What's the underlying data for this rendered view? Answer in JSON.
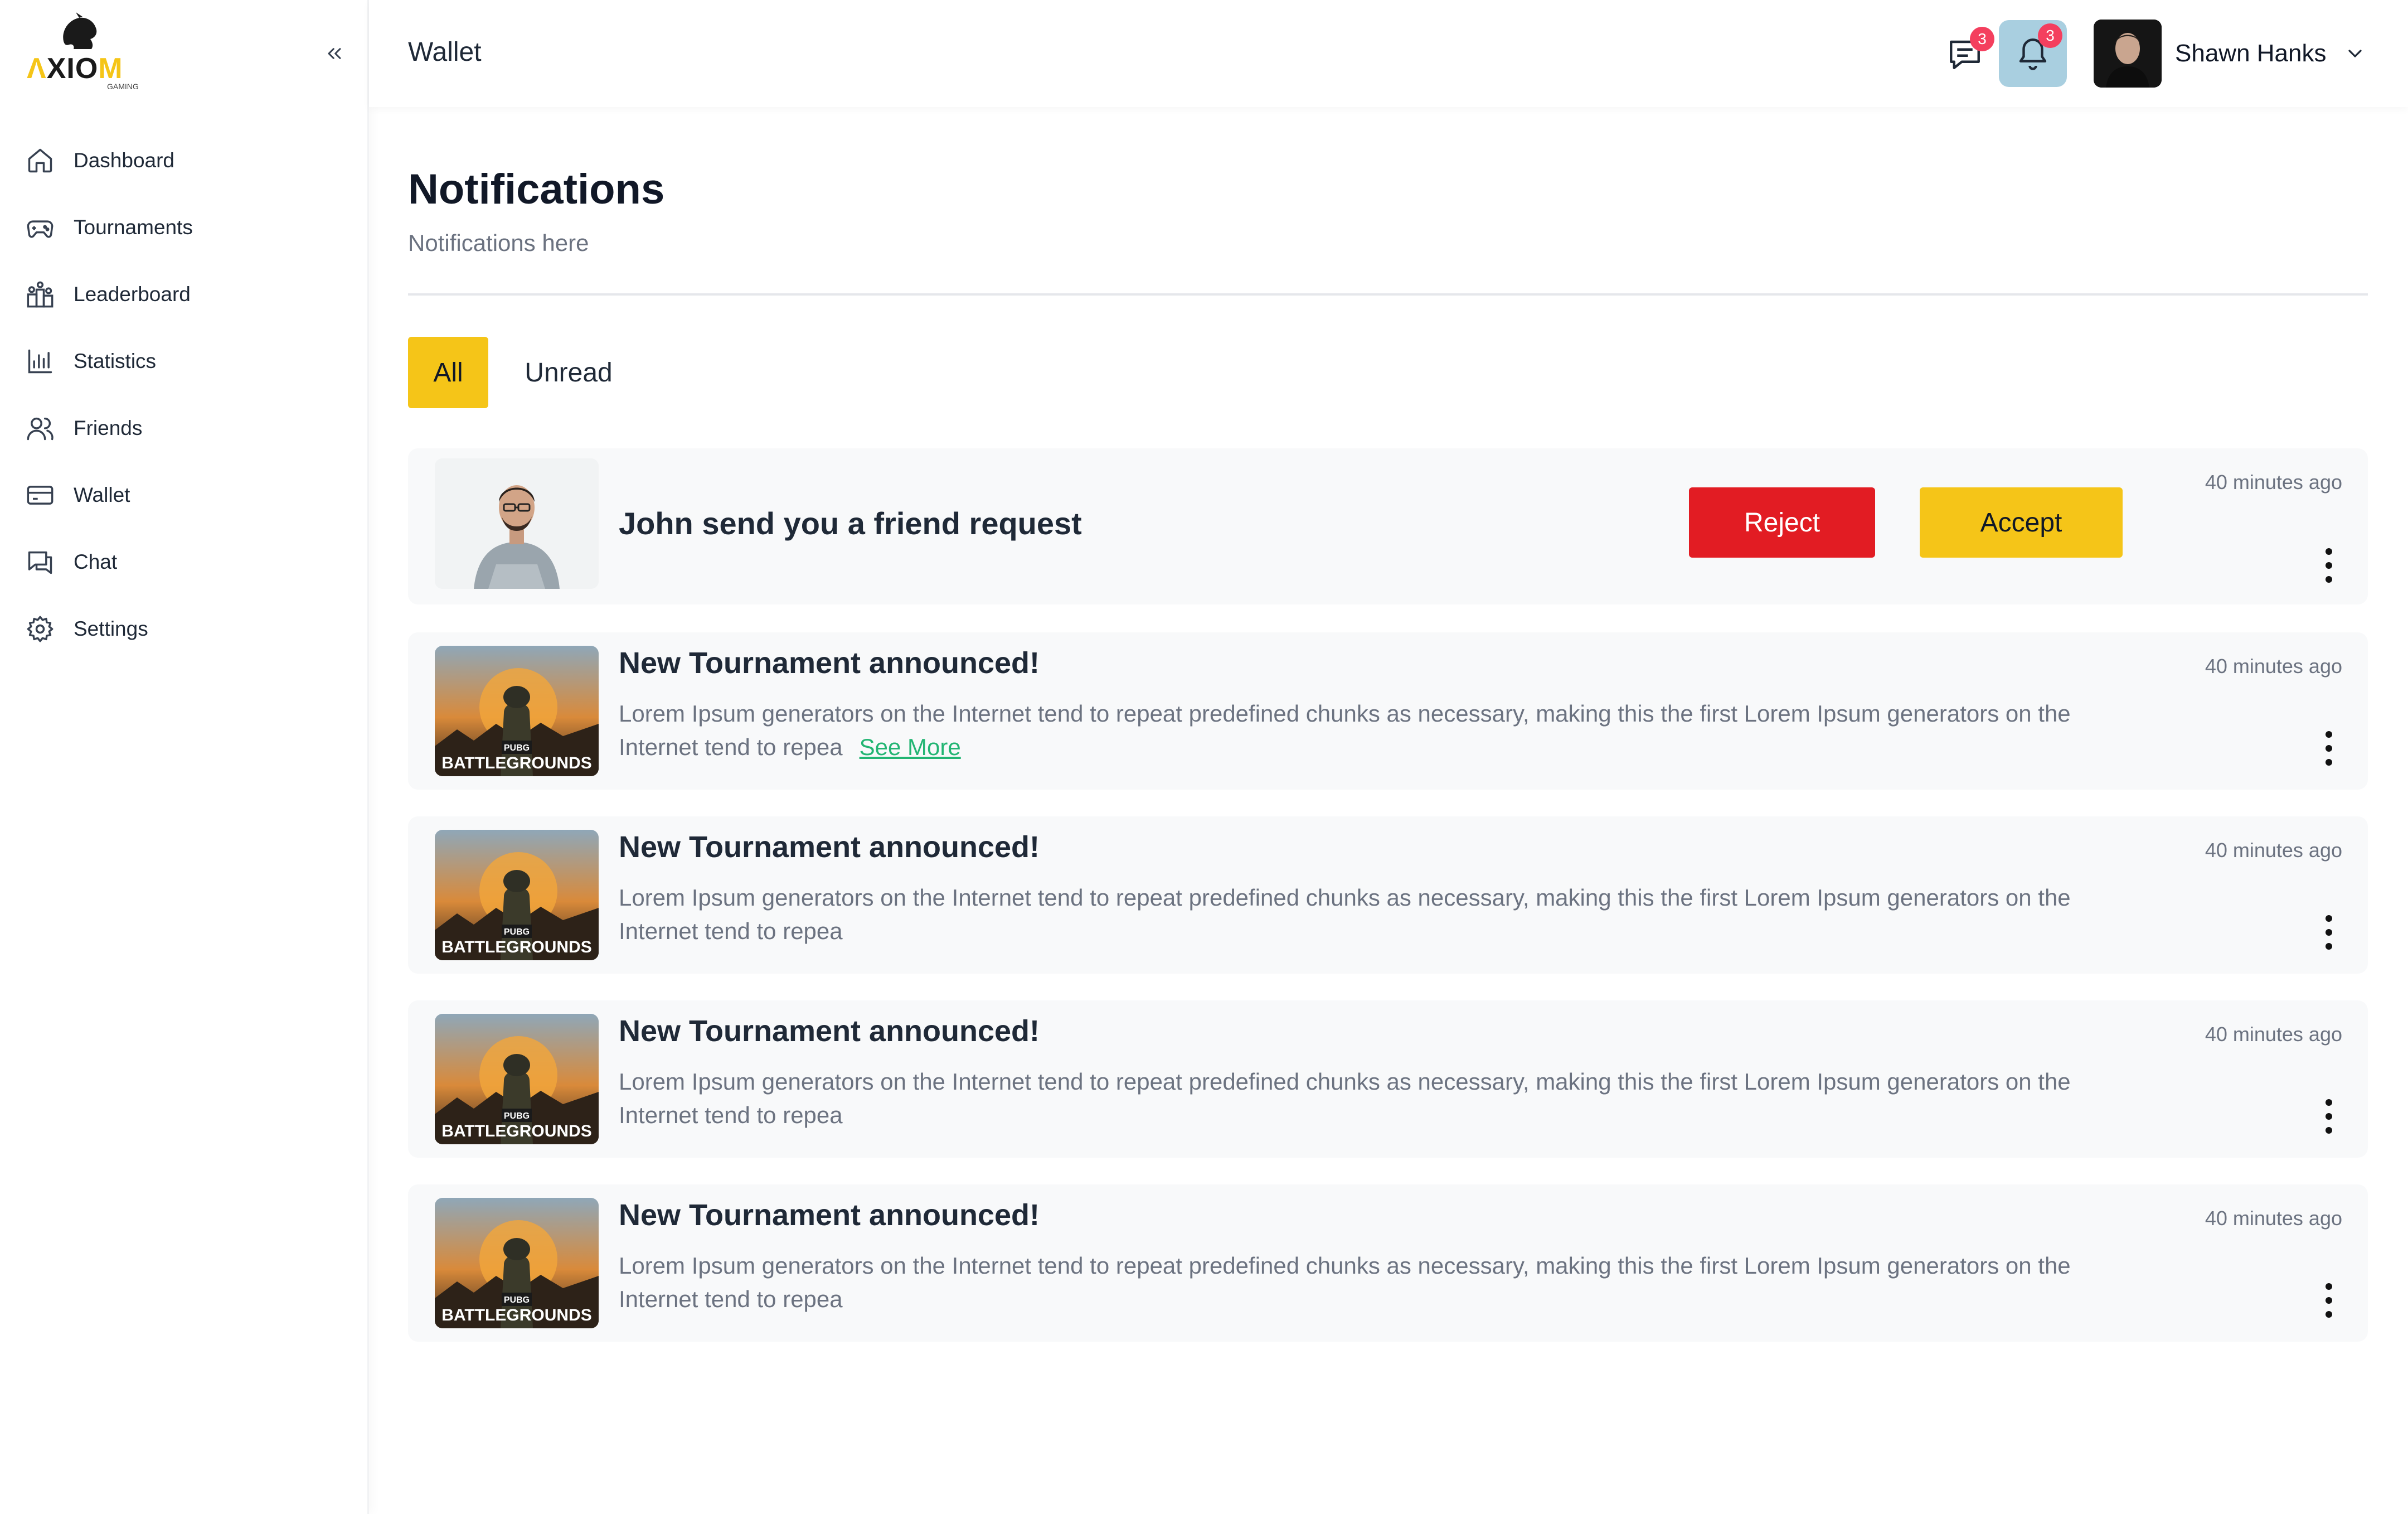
{
  "brand": {
    "name": "AXIOM",
    "tagline": "GAMING",
    "accent": "#f5c518"
  },
  "sidebar": {
    "items": [
      {
        "label": "Dashboard",
        "icon": "home-icon"
      },
      {
        "label": "Tournaments",
        "icon": "gamepad-icon"
      },
      {
        "label": "Leaderboard",
        "icon": "leaderboard-icon"
      },
      {
        "label": "Statistics",
        "icon": "bar-chart-icon"
      },
      {
        "label": "Friends",
        "icon": "users-icon"
      },
      {
        "label": "Wallet",
        "icon": "wallet-icon"
      },
      {
        "label": "Chat",
        "icon": "chat-icon"
      },
      {
        "label": "Settings",
        "icon": "gear-icon"
      }
    ]
  },
  "header": {
    "title": "Wallet",
    "messages_badge": "3",
    "notifications_badge": "3",
    "user_name": "Shawn Hanks"
  },
  "main": {
    "title": "Notifications",
    "subtitle": "Notifications here",
    "tabs": [
      {
        "label": "All",
        "active": true
      },
      {
        "label": "Unread",
        "active": false
      }
    ]
  },
  "notifications": [
    {
      "type": "friend_request",
      "title": "John send you a friend request",
      "time": "40 minutes ago",
      "reject_label": "Reject",
      "accept_label": "Accept"
    },
    {
      "type": "tournament",
      "title": "New Tournament announced!",
      "body": "Lorem Ipsum generators on the Internet tend to repeat predefined chunks as necessary, making this the first Lorem Ipsum generators on the Internet tend to repea",
      "see_more": "See More",
      "time": "40 minutes ago",
      "thumb_caption": "BATTLEGROUNDS",
      "thumb_small": "PUBG"
    },
    {
      "type": "tournament",
      "title": "New Tournament announced!",
      "body": "Lorem Ipsum generators on the Internet tend to repeat predefined chunks as necessary, making this the first Lorem Ipsum generators on the Internet tend to repea",
      "time": "40 minutes ago",
      "thumb_caption": "BATTLEGROUNDS",
      "thumb_small": "PUBG"
    },
    {
      "type": "tournament",
      "title": "New Tournament announced!",
      "body": "Lorem Ipsum generators on the Internet tend to repeat predefined chunks as necessary, making this the first Lorem Ipsum generators on the Internet tend to repea",
      "time": "40 minutes ago",
      "thumb_caption": "BATTLEGROUNDS",
      "thumb_small": "PUBG"
    },
    {
      "type": "tournament",
      "title": "New Tournament announced!",
      "body": "Lorem Ipsum generators on the Internet tend to repeat predefined chunks as necessary, making this the first Lorem Ipsum generators on the Internet tend to repea",
      "time": "40 minutes ago",
      "thumb_caption": "BATTLEGROUNDS",
      "thumb_small": "PUBG"
    }
  ]
}
